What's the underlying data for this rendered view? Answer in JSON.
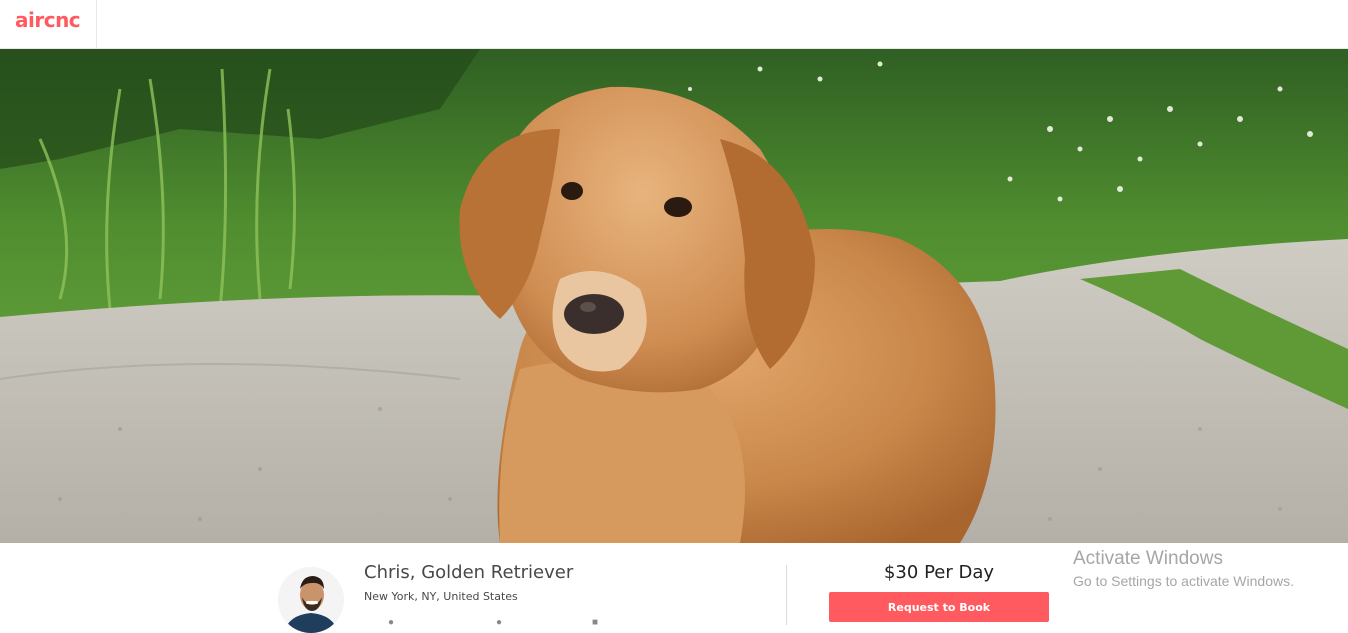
{
  "header": {
    "logo_text": "aircnc"
  },
  "hero": {
    "image_subject": "golden-retriever-photo"
  },
  "listing": {
    "title": "Chris, Golden Retriever",
    "location": "New York, NY, United States",
    "amenity_icons": [
      "group-icon",
      "pet-icon",
      "calendar-icon"
    ]
  },
  "booking": {
    "price": "$30 Per Day",
    "button_label": "Request to Book"
  },
  "watermark": {
    "title": "Activate Windows",
    "subtitle": "Go to Settings to activate Windows."
  },
  "colors": {
    "brand": "#ff5a5f",
    "text": "#484848",
    "watermark": "#a6a6a6"
  }
}
